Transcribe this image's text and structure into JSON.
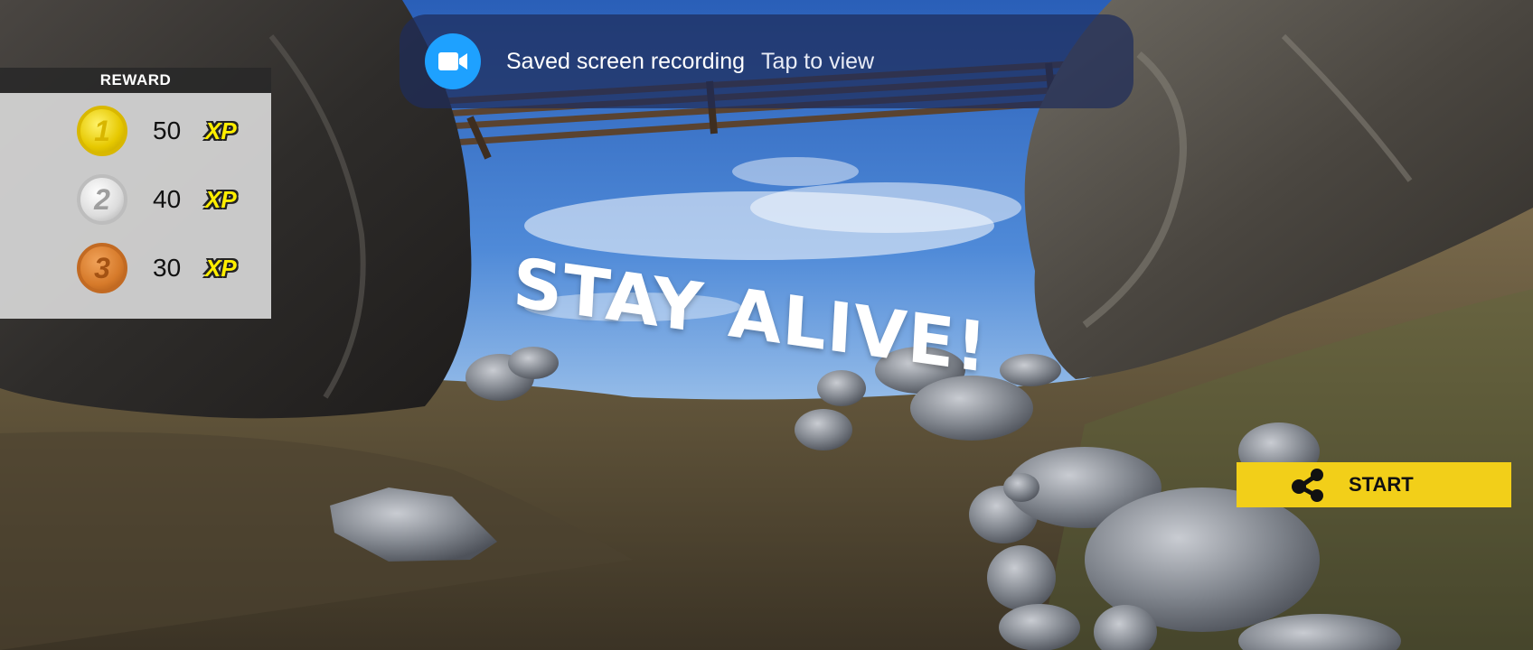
{
  "reward": {
    "title": "REWARD",
    "rows": [
      {
        "place": "1",
        "xp": "50",
        "label": "XP",
        "medal": "gold-medal-icon"
      },
      {
        "place": "2",
        "xp": "40",
        "label": "XP",
        "medal": "silver-medal-icon"
      },
      {
        "place": "3",
        "xp": "30",
        "label": "XP",
        "medal": "bronze-medal-icon"
      }
    ]
  },
  "notification": {
    "icon": "video-camera-icon",
    "title": "Saved screen recording",
    "action": "Tap to view"
  },
  "headline": "STAY ALIVE!",
  "start_button": {
    "icon": "share-icon",
    "label": "START"
  },
  "colors": {
    "start_button": "#f2cf19",
    "xp_label": "#ffee00",
    "notification_icon": "#1ea1ff"
  }
}
